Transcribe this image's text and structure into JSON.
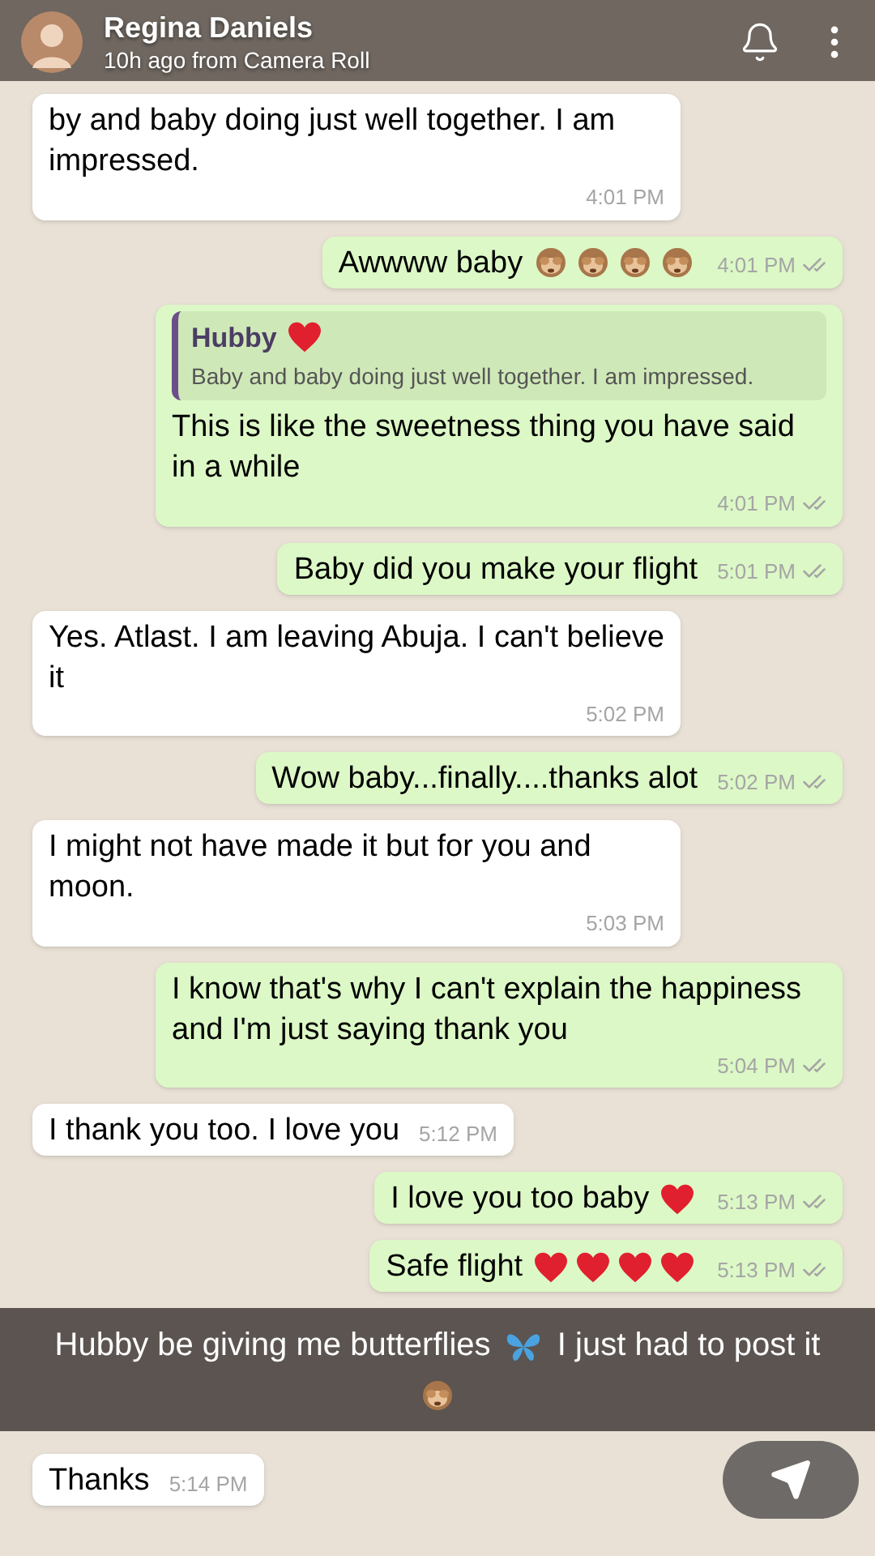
{
  "story_header": {
    "name": "Regina Daniels",
    "subtitle": "10h ago from Camera Roll"
  },
  "messages": [
    {
      "kind": "incoming",
      "text": "by and baby doing just well together. I am impressed.",
      "time": "4:01 PM"
    },
    {
      "kind": "outgoing",
      "text": "Awwww baby",
      "icons": [
        {
          "kind": "monkey"
        },
        {
          "kind": "monkey"
        },
        {
          "kind": "monkey"
        },
        {
          "kind": "monkey"
        }
      ],
      "time": "4:01 PM"
    },
    {
      "kind": "outgoing",
      "quote": {
        "author": "Hubby",
        "author_icons": [
          {
            "kind": "heart"
          }
        ],
        "text": "Baby and baby doing just well together. I am impressed."
      },
      "text": "This is like the sweetness thing you have said in a while",
      "time": "4:01 PM"
    },
    {
      "kind": "outgoing",
      "text": "Baby did you make your flight",
      "time": "5:01 PM"
    },
    {
      "kind": "incoming",
      "text": "Yes. Atlast. I am leaving Abuja. I can't believe it",
      "time": "5:02 PM"
    },
    {
      "kind": "outgoing",
      "text": "Wow baby...finally....thanks alot",
      "time": "5:02 PM"
    },
    {
      "kind": "incoming",
      "text": "I might not have made it but for you and moon.",
      "time": "5:03 PM"
    },
    {
      "kind": "outgoing",
      "text": "I know that's why I can't explain the happiness and I'm just saying thank you",
      "time": "5:04 PM"
    },
    {
      "kind": "incoming",
      "text": "I thank you too. I love you",
      "time": "5:12 PM"
    },
    {
      "kind": "outgoing",
      "text": "I love you too baby",
      "icons": [
        {
          "kind": "heart"
        }
      ],
      "time": "5:13 PM"
    },
    {
      "kind": "outgoing",
      "text": "Safe flight",
      "icons": [
        {
          "kind": "heart"
        },
        {
          "kind": "heart"
        },
        {
          "kind": "heart"
        },
        {
          "kind": "heart"
        }
      ],
      "time": "5:13 PM"
    }
  ],
  "caption": {
    "text": "Hubby be giving me butterflies",
    "middle_icons": [
      {
        "kind": "butterfly"
      }
    ],
    "text_after": "I just had to post it",
    "end_icons": [
      {
        "kind": "monkey"
      }
    ]
  },
  "last_message": {
    "kind": "incoming",
    "text": "Thanks",
    "time": "5:14 PM"
  }
}
